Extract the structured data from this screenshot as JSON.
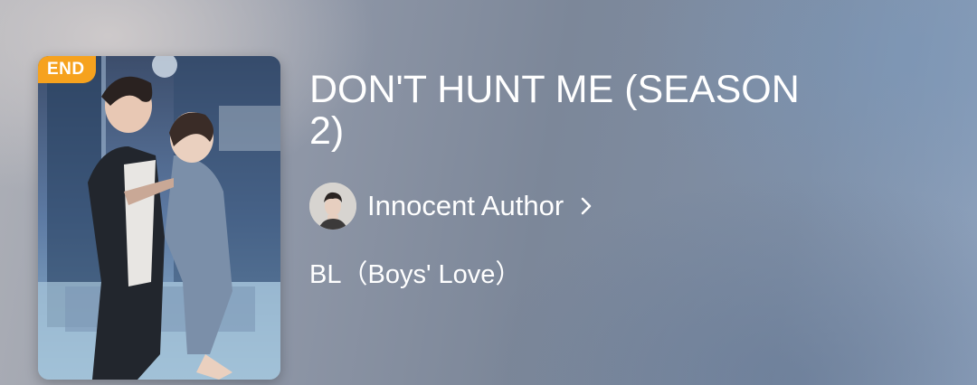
{
  "book": {
    "status_badge": "END",
    "title": "DON'T HUNT ME (SEASON 2)",
    "author": "Innocent Author",
    "genre": "BL（Boys' Love）"
  },
  "icons": {
    "author_chevron": "chevron-right-icon",
    "avatar": "author-avatar"
  },
  "colors": {
    "badge": "#f6a21e",
    "text": "#ffffff"
  }
}
